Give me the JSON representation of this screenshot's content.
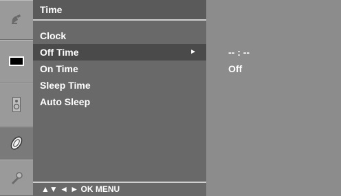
{
  "menu": {
    "title": "Time",
    "items": [
      {
        "label": "Clock"
      },
      {
        "label": "Off Time"
      },
      {
        "label": "On Time"
      },
      {
        "label": "Sleep Time"
      },
      {
        "label": "Auto Sleep"
      }
    ],
    "selected_index": 1,
    "submenu_arrow": "►"
  },
  "panel": {
    "time_value": "-- : --",
    "state_value": "Off"
  },
  "footer": {
    "hint": "▲▼  ◄ ►  OK  MENU"
  },
  "rail": {
    "icons": [
      "satellite-dish-icon",
      "screen-picture-icon",
      "speaker-icon",
      "disc-time-icon",
      "wrench-option-icon"
    ],
    "active_index": 3
  },
  "colors": {
    "rail": "#8c8c8c",
    "menu": "#696969",
    "selected_row": "#4a4a4a",
    "panel": "#8c8c8c",
    "text": "#ffffff"
  }
}
